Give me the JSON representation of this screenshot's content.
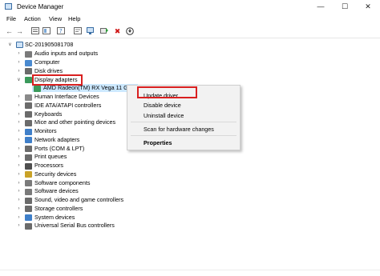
{
  "window": {
    "title": "Device Manager",
    "minimize_label": "—",
    "maximize_label": "☐",
    "close_label": "✕"
  },
  "menu": [
    "File",
    "Action",
    "View",
    "Help"
  ],
  "toolbar": {
    "icons": [
      "back-arrow-icon",
      "forward-arrow-icon",
      "properties-pane-icon",
      "show-hidden-icon",
      "help-icon",
      "driver-info-icon",
      "scan-hardware-icon",
      "update-driver-icon",
      "uninstall-device-icon",
      "download-icon"
    ]
  },
  "tree": {
    "root": "SC-201905081708",
    "items": [
      {
        "label": "Audio inputs and outputs",
        "expander": ">",
        "icon": "speaker-icon",
        "color": "#7a7a7a"
      },
      {
        "label": "Computer",
        "expander": ">",
        "icon": "computer-icon",
        "color": "#4a8ad0"
      },
      {
        "label": "Disk drives",
        "expander": ">",
        "icon": "disk-drive-icon",
        "color": "#6b6b6b"
      },
      {
        "label": "Display adapters",
        "expander": "v",
        "icon": "display-adapter-icon",
        "color": "#3b9a5b"
      },
      {
        "label": "AMD Radeon(TM) RX Vega 11 Graphics",
        "expander": "",
        "icon": "display-adapter-icon",
        "color": "#3b9a5b",
        "child": true
      },
      {
        "label": "Human Interface Devices",
        "expander": ">",
        "icon": "hid-icon",
        "color": "#8a8a8a"
      },
      {
        "label": "IDE ATA/ATAPI controllers",
        "expander": ">",
        "icon": "ide-controller-icon",
        "color": "#6b6b6b"
      },
      {
        "label": "Keyboards",
        "expander": ">",
        "icon": "keyboard-icon",
        "color": "#6b6b6b"
      },
      {
        "label": "Mice and other pointing devices",
        "expander": ">",
        "icon": "mouse-icon",
        "color": "#6b6b6b"
      },
      {
        "label": "Monitors",
        "expander": ">",
        "icon": "monitor-icon",
        "color": "#3f7fc9"
      },
      {
        "label": "Network adapters",
        "expander": ">",
        "icon": "network-adapter-icon",
        "color": "#3f7fc9"
      },
      {
        "label": "Ports (COM & LPT)",
        "expander": ">",
        "icon": "port-icon",
        "color": "#6b6b6b"
      },
      {
        "label": "Print queues",
        "expander": ">",
        "icon": "printer-icon",
        "color": "#6b6b6b"
      },
      {
        "label": "Processors",
        "expander": ">",
        "icon": "processor-icon",
        "color": "#4f4f4f"
      },
      {
        "label": "Security devices",
        "expander": ">",
        "icon": "security-device-icon",
        "color": "#c9a227"
      },
      {
        "label": "Software components",
        "expander": ">",
        "icon": "software-component-icon",
        "color": "#7a7a7a"
      },
      {
        "label": "Software devices",
        "expander": ">",
        "icon": "software-device-icon",
        "color": "#7a7a7a"
      },
      {
        "label": "Sound, video and game controllers",
        "expander": ">",
        "icon": "sound-controller-icon",
        "color": "#6b6b6b"
      },
      {
        "label": "Storage controllers",
        "expander": ">",
        "icon": "storage-controller-icon",
        "color": "#6b6b6b"
      },
      {
        "label": "System devices",
        "expander": ">",
        "icon": "system-device-icon",
        "color": "#3f7fc9"
      },
      {
        "label": "Universal Serial Bus controllers",
        "expander": ">",
        "icon": "usb-controller-icon",
        "color": "#6b6b6b"
      }
    ]
  },
  "context_menu": {
    "items": [
      "Update driver",
      "Disable device",
      "Uninstall device",
      "Scan for hardware changes",
      "Properties"
    ]
  },
  "colors": {
    "highlight_red": "#d92020",
    "selection": "#cce8ff"
  }
}
